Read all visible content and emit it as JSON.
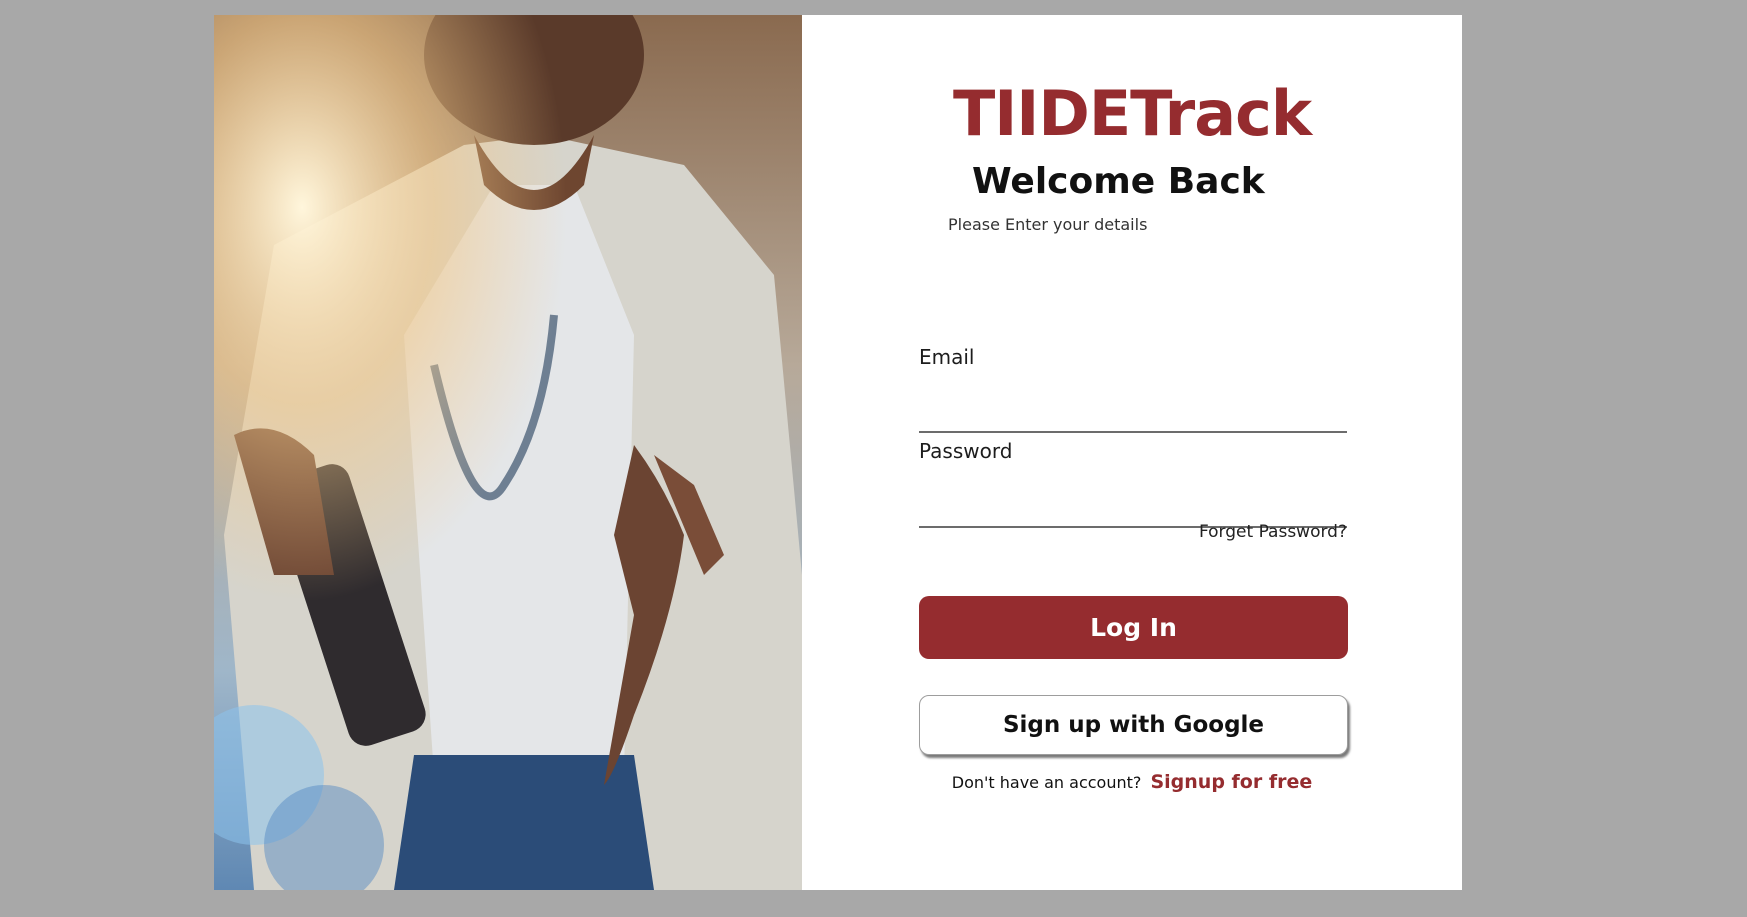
{
  "brand": {
    "name": "TIIDETrack",
    "color": "#952c2f"
  },
  "header": {
    "title": "Welcome Back",
    "subtitle": "Please Enter your details"
  },
  "form": {
    "email_label": "Email",
    "email_value": "",
    "password_label": "Password",
    "password_value": "",
    "forgot_label": "Forget Password?",
    "login_label": "Log In",
    "google_label": "Sign up with Google"
  },
  "footer": {
    "prompt": "Don't have an account?",
    "link_label": "Signup for free"
  },
  "colors": {
    "background": "#a8a8a8",
    "accent": "#952c2f",
    "card": "#ffffff"
  }
}
